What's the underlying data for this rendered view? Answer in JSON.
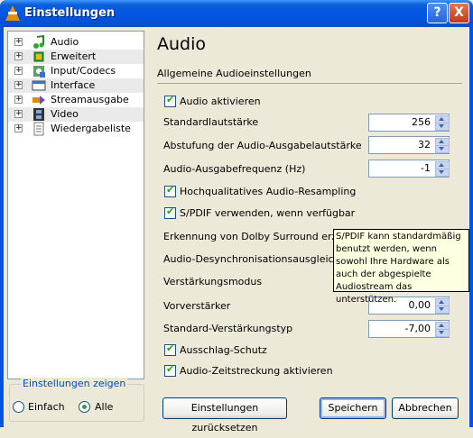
{
  "window": {
    "title": "Einstellungen",
    "help_label": "?",
    "close_label": "X"
  },
  "sidebar": {
    "items": [
      {
        "label": "Audio",
        "icon": "music-note-icon"
      },
      {
        "label": "Erweitert",
        "icon": "chip-icon"
      },
      {
        "label": "Input/Codecs",
        "icon": "codec-icon"
      },
      {
        "label": "Interface",
        "icon": "interface-icon"
      },
      {
        "label": "Streamausgabe",
        "icon": "stream-icon"
      },
      {
        "label": "Video",
        "icon": "film-icon"
      },
      {
        "label": "Wiedergabeliste",
        "icon": "playlist-icon"
      }
    ],
    "expander": "+"
  },
  "show_settings": {
    "title": "Einstellungen zeigen",
    "options": [
      "Einfach",
      "Alle"
    ],
    "selected": "Alle"
  },
  "main": {
    "title": "Audio",
    "subtitle": "Allgemeine Audioeinstellungen",
    "enable_audio": {
      "label": "Audio aktivieren",
      "checked": true
    },
    "default_volume": {
      "label": "Standardlautstärke",
      "value": "256"
    },
    "volume_step": {
      "label": "Abstufung der Audio-Ausgabelautstärke",
      "value": "32"
    },
    "output_rate": {
      "label": "Audio-Ausgabefrequenz (Hz)",
      "value": "-1"
    },
    "hq_resampling": {
      "label": "Hochqualitatives Audio-Resampling",
      "checked": true
    },
    "spdif": {
      "label": "S/PDIF verwenden, wenn verfügbar",
      "checked": true
    },
    "dolby": {
      "label": "Erkennung von Dolby Surround erzwing"
    },
    "desync": {
      "label": "Audio-Desynchronisationsausgleich"
    },
    "gain_mode": {
      "label": "Verstärkungsmodus"
    },
    "preamp": {
      "label": "Vorverstärker",
      "value": "0,00"
    },
    "default_gain": {
      "label": "Standard-Verstärkungstyp",
      "value": "-7,00"
    },
    "clipping": {
      "label": "Ausschlag-Schutz",
      "checked": true
    },
    "time_stretch": {
      "label": "Audio-Zeitstreckung aktivieren",
      "checked": true
    }
  },
  "tooltip": {
    "text": "S/PDIF kann standardmäßig benutzt werden, wenn sowohl Ihre Hardware als auch der abgespielte Audiostream das unterstützen."
  },
  "buttons": {
    "reset": "Einstellungen zurücksetzen",
    "save": "Speichern",
    "cancel": "Abbrechen"
  },
  "colors": {
    "titlebar": "#0054e3",
    "check": "#21a121",
    "radio_dot": "#22a83b",
    "group_title": "#0046d5",
    "tooltip_bg": "#ffffe1"
  }
}
